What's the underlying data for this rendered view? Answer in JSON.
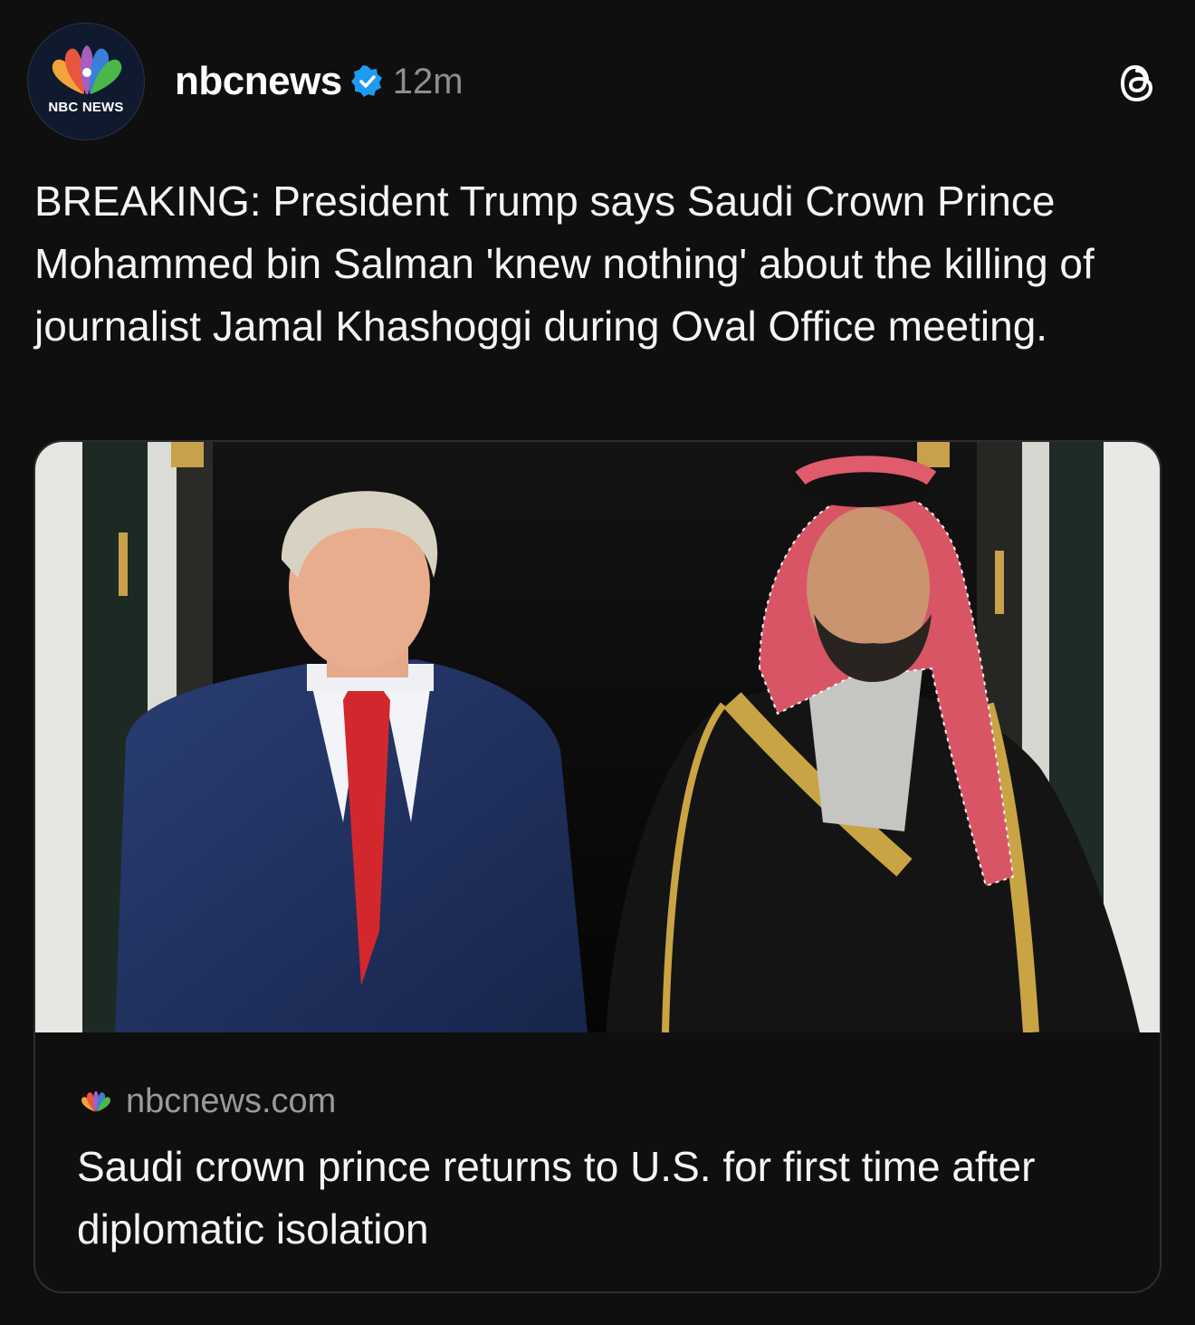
{
  "account": {
    "avatar_brand": "NBC NEWS",
    "username": "nbcnews",
    "verified": true,
    "time": "12m"
  },
  "post": {
    "text": "BREAKING: President Trump says Saudi Crown Prince Mohammed bin Salman 'knew nothing' about the killing of journalist Jamal Khashoggi during Oval Office meeting."
  },
  "link_card": {
    "domain": "nbcnews.com",
    "title": "Saudi crown prince returns to U.S. for first time after diplomatic isolation"
  },
  "icons": {
    "avatar": "nbc-peacock-icon",
    "verified": "verified-badge-icon",
    "app": "threads-icon",
    "domain": "nbc-peacock-icon"
  },
  "colors": {
    "background": "#0f0f0f",
    "text": "#f3f5f7",
    "muted": "#8e8e8e",
    "verified": "#1d9bf0",
    "peacock": [
      "#f2a33a",
      "#e9563f",
      "#a45fc1",
      "#3a7fd9",
      "#4bb749",
      "#f6d13c"
    ]
  }
}
